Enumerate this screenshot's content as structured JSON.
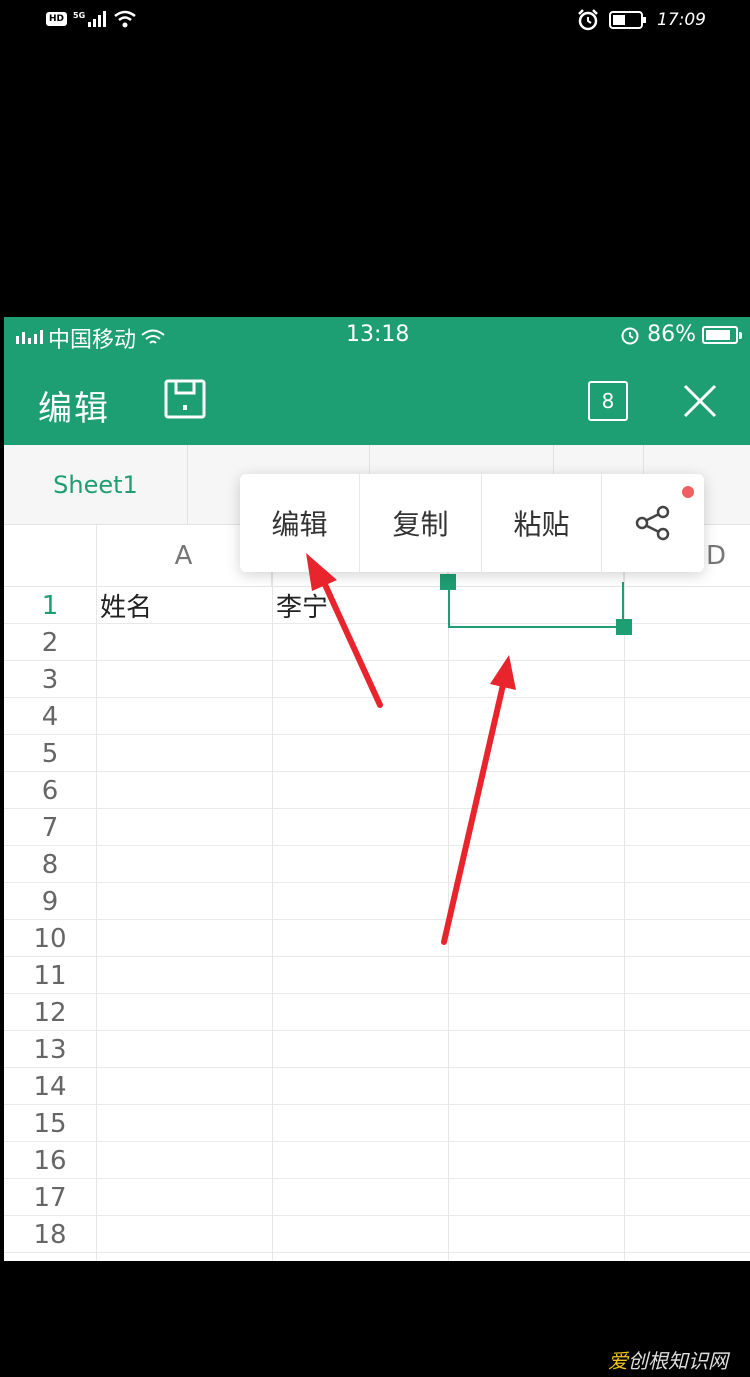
{
  "outer_status": {
    "hd": "HD",
    "network": "5G",
    "time": "17:09"
  },
  "app_status": {
    "carrier": "中国移动",
    "time": "13:18",
    "battery": "86%",
    "battery_level": 0.86
  },
  "toolbar": {
    "title": "编辑",
    "sheet_count": "8"
  },
  "sheet_tabs": {
    "active": "Sheet1"
  },
  "columns": [
    "A",
    "D"
  ],
  "rows": [
    {
      "num": "1",
      "a": "姓名",
      "b": "李宁"
    },
    {
      "num": "2",
      "a": "",
      "b": ""
    },
    {
      "num": "3",
      "a": "",
      "b": ""
    },
    {
      "num": "4",
      "a": "",
      "b": ""
    },
    {
      "num": "5",
      "a": "",
      "b": ""
    },
    {
      "num": "6",
      "a": "",
      "b": ""
    },
    {
      "num": "7",
      "a": "",
      "b": ""
    },
    {
      "num": "8",
      "a": "",
      "b": ""
    },
    {
      "num": "9",
      "a": "",
      "b": ""
    },
    {
      "num": "10",
      "a": "",
      "b": ""
    },
    {
      "num": "11",
      "a": "",
      "b": ""
    },
    {
      "num": "12",
      "a": "",
      "b": ""
    },
    {
      "num": "13",
      "a": "",
      "b": ""
    },
    {
      "num": "14",
      "a": "",
      "b": ""
    },
    {
      "num": "15",
      "a": "",
      "b": ""
    },
    {
      "num": "16",
      "a": "",
      "b": ""
    },
    {
      "num": "17",
      "a": "",
      "b": ""
    },
    {
      "num": "18",
      "a": "",
      "b": ""
    }
  ],
  "context_menu": {
    "edit": "编辑",
    "copy": "复制",
    "paste": "粘贴",
    "share_icon": "share-icon"
  },
  "colors": {
    "accent": "#1e9e73",
    "annotation_arrow": "#e8242c",
    "badge_dot": "#f06060"
  },
  "watermark": {
    "accent_text": "爱",
    "text": "创根知识网"
  }
}
